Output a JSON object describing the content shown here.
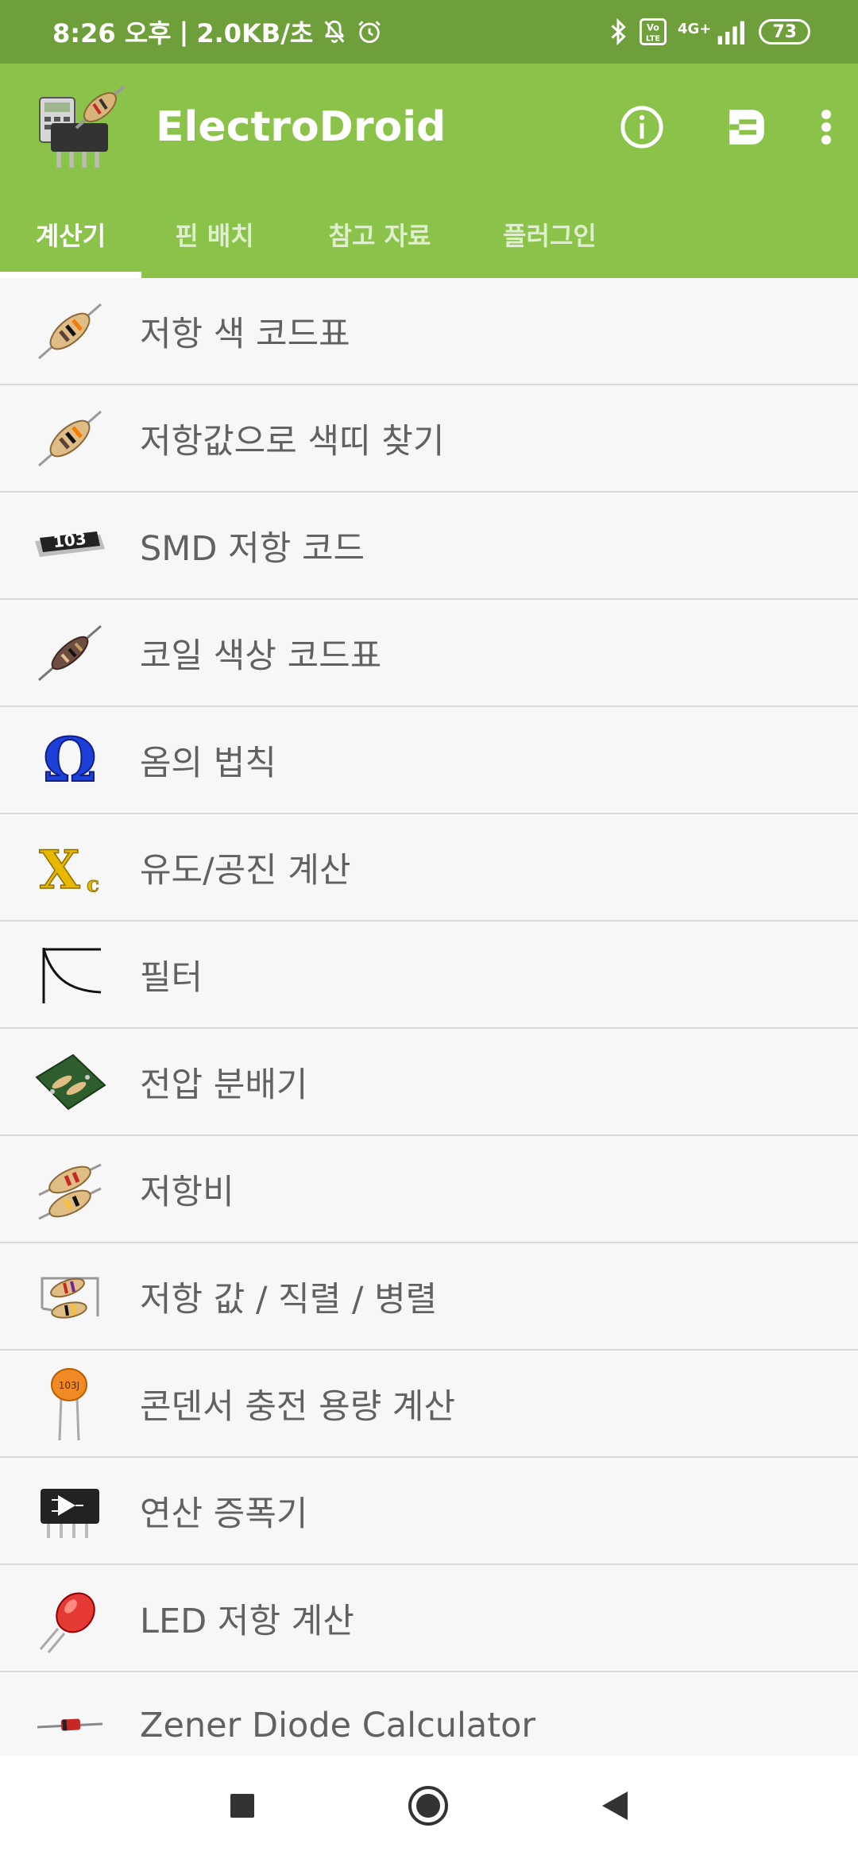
{
  "status": {
    "time": "8:26 오후",
    "speed": "2.0KB/초",
    "network": "4G+",
    "volte": "Vo LTE",
    "battery": "73"
  },
  "app": {
    "title": "ElectroDroid",
    "actions": [
      "info-icon",
      "plugin-connector-icon",
      "more-vert-icon"
    ]
  },
  "tabs": [
    {
      "label": "계산기",
      "active": true
    },
    {
      "label": "핀 배치",
      "active": false
    },
    {
      "label": "참고 자료",
      "active": false
    },
    {
      "label": "플러그인",
      "active": false
    }
  ],
  "items": [
    {
      "label": "저항 색 코드표",
      "icon": "resistor-icon"
    },
    {
      "label": "저항값으로 색띠 찾기",
      "icon": "resistor-icon"
    },
    {
      "label": "SMD 저항 코드",
      "icon": "smd-resistor-icon",
      "icon_text": "103"
    },
    {
      "label": "코일 색상 코드표",
      "icon": "inductor-icon"
    },
    {
      "label": "옴의 법칙",
      "icon": "omega-icon",
      "icon_text": "Ω"
    },
    {
      "label": "유도/공진 계산",
      "icon": "reactance-icon",
      "icon_text": "X"
    },
    {
      "label": "필터",
      "icon": "filter-curve-icon"
    },
    {
      "label": "전압 분배기",
      "icon": "circuit-board-icon"
    },
    {
      "label": "저항비",
      "icon": "two-resistors-icon"
    },
    {
      "label": "저항 값 / 직렬 / 병렬",
      "icon": "resistor-network-icon"
    },
    {
      "label": "콘덴서 충전 용량 계산",
      "icon": "capacitor-icon",
      "icon_text": "103J"
    },
    {
      "label": "연산 증폭기",
      "icon": "opamp-chip-icon"
    },
    {
      "label": "LED 저항 계산",
      "icon": "led-icon"
    },
    {
      "label": "Zener Diode Calculator",
      "icon": "zener-diode-icon"
    }
  ],
  "navbar": [
    "recents-icon",
    "home-icon",
    "back-icon"
  ],
  "colors": {
    "status_bar": "#6f9f3a",
    "app_bar": "#8bc34a",
    "text": "#616161",
    "divider": "#d9d9d9"
  }
}
